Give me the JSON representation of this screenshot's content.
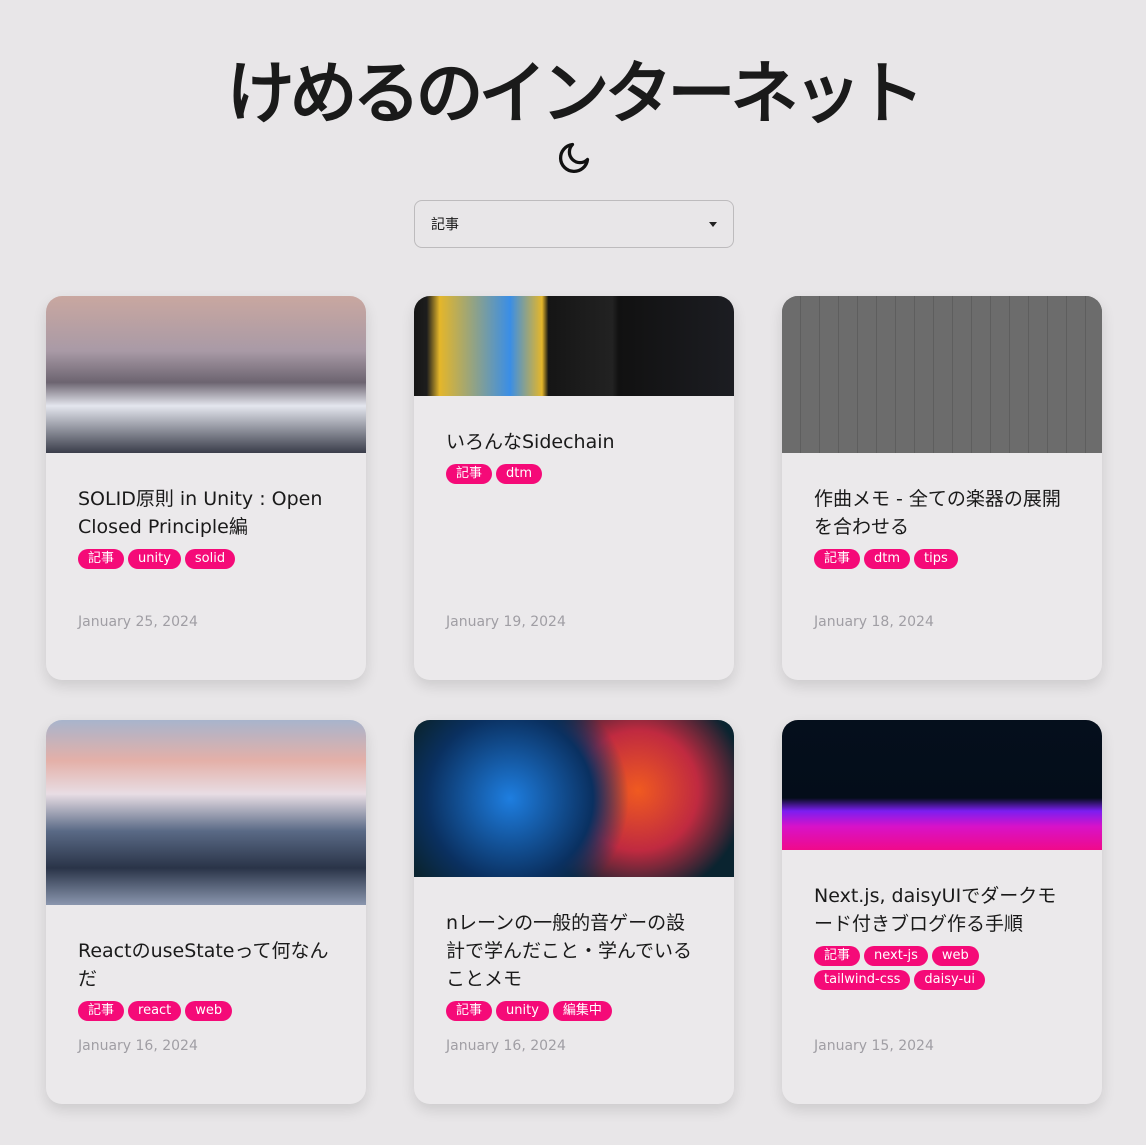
{
  "header": {
    "title": "けめるのインターネット",
    "theme_icon": "moon-icon"
  },
  "filter": {
    "selected": "記事"
  },
  "colors": {
    "tag": "#f50a78",
    "background": "#e8e6e8"
  },
  "posts": [
    {
      "title": "SOLID原則 in Unity : Open Closed Principle編",
      "tags": [
        "記事",
        "unity",
        "solid"
      ],
      "date": "January 25, 2024"
    },
    {
      "title": "いろんなSidechain",
      "tags": [
        "記事",
        "dtm"
      ],
      "date": "January 19, 2024"
    },
    {
      "title": "作曲メモ - 全ての楽器の展開を合わせる",
      "tags": [
        "記事",
        "dtm",
        "tips"
      ],
      "date": "January 18, 2024"
    },
    {
      "title": "ReactのuseStateって何なんだ",
      "tags": [
        "記事",
        "react",
        "web"
      ],
      "date": "January 16, 2024"
    },
    {
      "title": "nレーンの一般的音ゲーの設計で学んだこと・学んでいることメモ",
      "tags": [
        "記事",
        "unity",
        "編集中"
      ],
      "date": "January 16, 2024"
    },
    {
      "title": "Next.js, daisyUIでダークモード付きブログ作る手順",
      "tags": [
        "記事",
        "next-js",
        "web",
        "tailwind-css",
        "daisy-ui"
      ],
      "date": "January 15, 2024"
    }
  ]
}
